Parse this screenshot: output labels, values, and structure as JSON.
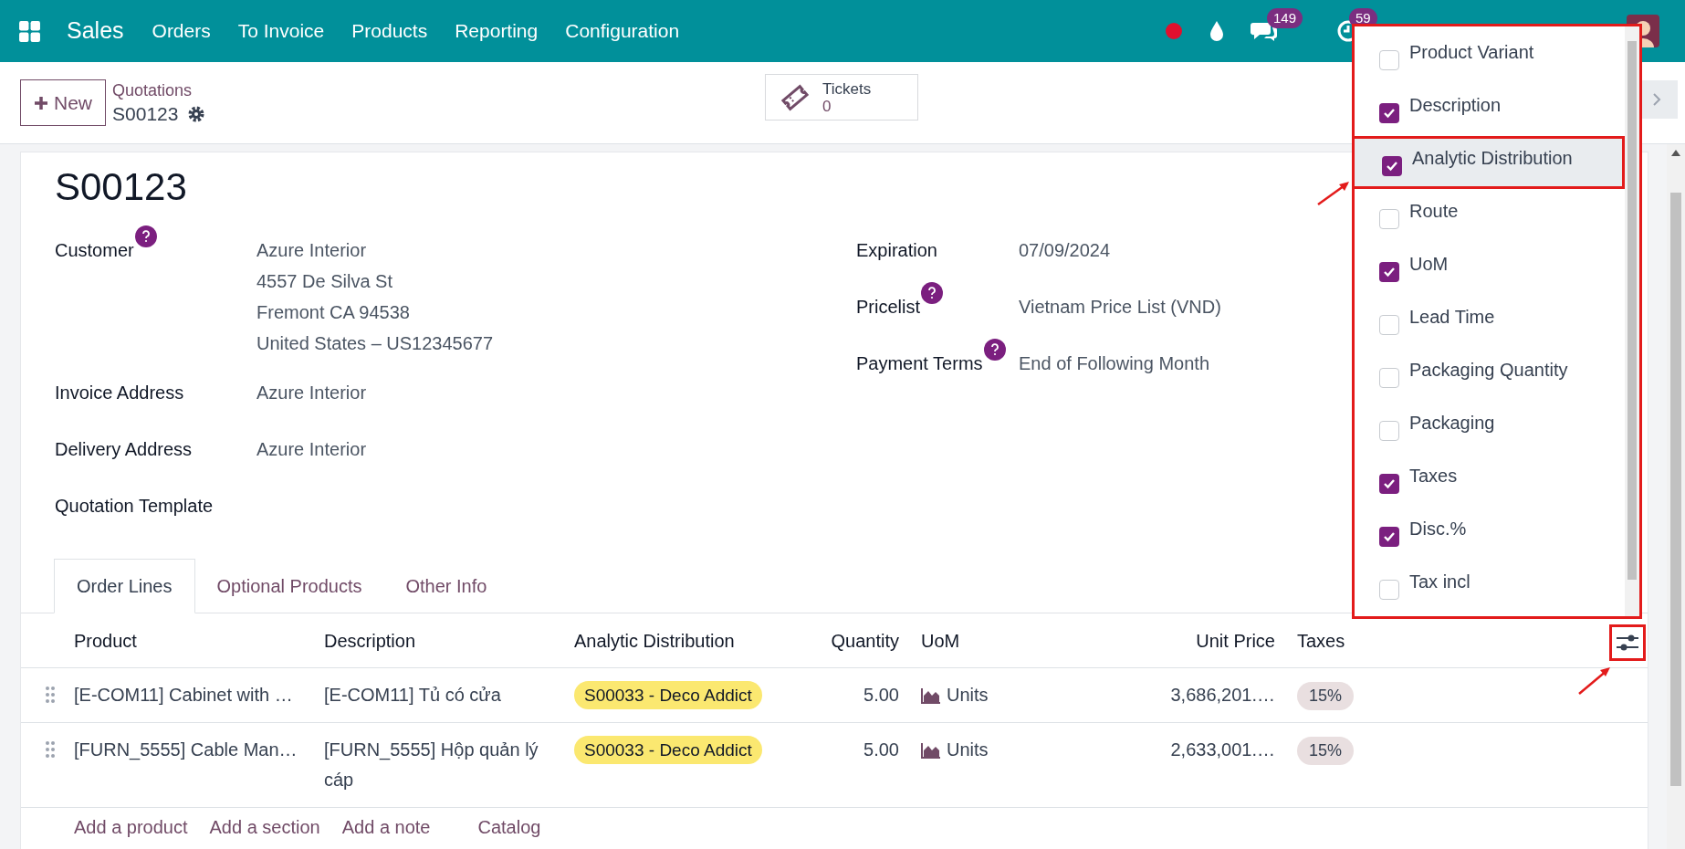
{
  "navbar": {
    "app": "Sales",
    "menu": [
      "Orders",
      "To Invoice",
      "Products",
      "Reporting",
      "Configuration"
    ],
    "messages_badge": "149",
    "activities_badge": "59"
  },
  "control_panel": {
    "new_button": "New",
    "breadcrumb": "Quotations",
    "record": "S00123",
    "smart_button": {
      "label": "Tickets",
      "value": "0"
    }
  },
  "form": {
    "title": "S00123",
    "left_fields": [
      {
        "label": "Customer",
        "help": true,
        "lines": [
          "Azure Interior",
          "4557 De Silva St",
          "Fremont CA 94538",
          "United States – US12345677"
        ]
      },
      {
        "label": "Invoice Address",
        "help": false,
        "lines": [
          "Azure Interior"
        ]
      },
      {
        "label": "Delivery Address",
        "help": false,
        "lines": [
          "Azure Interior"
        ]
      },
      {
        "label": "Quotation Template",
        "help": false
      }
    ],
    "right_fields": [
      {
        "label": "Expiration",
        "help": false,
        "lines": [
          "07/09/2024"
        ]
      },
      {
        "label": "Pricelist",
        "help": true,
        "lines": [
          "Vietnam Price List (VND)"
        ]
      },
      {
        "label": "Payment Terms",
        "help": true,
        "lines": [
          "End of Following Month"
        ]
      }
    ]
  },
  "tabs": [
    {
      "label": "Order Lines",
      "selected": true
    },
    {
      "label": "Optional Products",
      "selected": false
    },
    {
      "label": "Other Info",
      "selected": false
    }
  ],
  "table": {
    "columns": [
      "Product",
      "Description",
      "Analytic Distribution",
      "Quantity",
      "UoM",
      "Unit Price",
      "Taxes"
    ],
    "rows": [
      {
        "product": "[E-COM11] Cabinet with …",
        "description": "[E-COM11] Tủ có cửa",
        "analytic": "S00033 - Deco Addict",
        "quantity": "5.00",
        "uom": "Units",
        "unit_price": "3,686,201.…",
        "taxes": "15%"
      },
      {
        "product": "[FURN_5555] Cable Man…",
        "description": "[FURN_5555] Hộp quản lý cáp",
        "analytic": "S00033 - Deco Addict",
        "quantity": "5.00",
        "uom": "Units",
        "unit_price": "2,633,001.…",
        "taxes": "15%"
      }
    ],
    "actions": [
      "Add a product",
      "Add a section",
      "Add a note",
      "Catalog"
    ]
  },
  "column_menu": {
    "items": [
      {
        "label": "Product Variant",
        "checked": false,
        "highlighted": false
      },
      {
        "label": "Description",
        "checked": true,
        "highlighted": false
      },
      {
        "label": "Analytic Distribution",
        "checked": true,
        "highlighted": true
      },
      {
        "label": "Route",
        "checked": false,
        "highlighted": false
      },
      {
        "label": "UoM",
        "checked": true,
        "highlighted": false
      },
      {
        "label": "Lead Time",
        "checked": false,
        "highlighted": false
      },
      {
        "label": "Packaging Quantity",
        "checked": false,
        "highlighted": false
      },
      {
        "label": "Packaging",
        "checked": false,
        "highlighted": false
      },
      {
        "label": "Taxes",
        "checked": true,
        "highlighted": false
      },
      {
        "label": "Disc.%",
        "checked": true,
        "highlighted": false
      },
      {
        "label": "Tax incl",
        "checked": false,
        "highlighted": false
      }
    ]
  }
}
